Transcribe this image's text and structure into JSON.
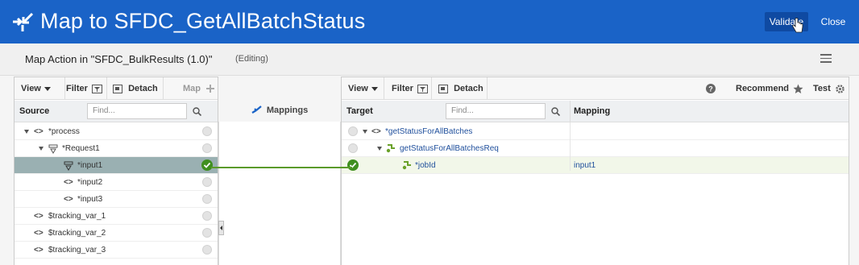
{
  "header": {
    "title": "Map to SFDC_GetAllBatchStatus",
    "validate_label": "Validate",
    "close_label": "Close"
  },
  "subheader": {
    "action_title": "Map Action in \"SFDC_BulkResults (1.0)\"",
    "status": "(Editing)"
  },
  "source": {
    "toolbar": {
      "view": "View",
      "filter": "Filter",
      "detach": "Detach",
      "map": "Map"
    },
    "column_label": "Source",
    "find_placeholder": "Find...",
    "rows": [
      {
        "label": "*process"
      },
      {
        "label": "*Request1"
      },
      {
        "label": "*input1"
      },
      {
        "label": "*input2"
      },
      {
        "label": "*input3"
      },
      {
        "label": "$tracking_var_1"
      },
      {
        "label": "$tracking_var_2"
      },
      {
        "label": "$tracking_var_3"
      }
    ]
  },
  "middle": {
    "mappings_label": "Mappings"
  },
  "target": {
    "toolbar": {
      "view": "View",
      "filter": "Filter",
      "detach": "Detach",
      "recommend": "Recommend",
      "test": "Test"
    },
    "column_label": "Target",
    "find_placeholder": "Find...",
    "mapping_column_label": "Mapping",
    "rows": [
      {
        "label": "*getStatusForAllBatches",
        "mapping": ""
      },
      {
        "label": "getStatusForAllBatchesReq",
        "mapping": ""
      },
      {
        "label": "*jobId",
        "mapping": "input1"
      }
    ]
  },
  "colors": {
    "header_bg": "#1a63c7",
    "validate_bg": "#0f4aa2",
    "mapped_green": "#3f8f1f",
    "selected_row": "#9ab0b2"
  }
}
